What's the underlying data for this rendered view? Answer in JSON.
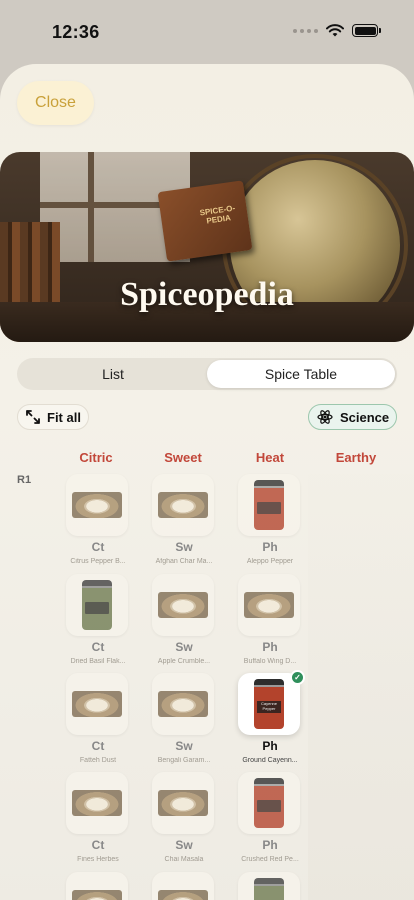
{
  "status": {
    "time": "12:36"
  },
  "sheet": {
    "close_label": "Close",
    "hero": {
      "title": "Spiceopedia",
      "book_title": "SPICE-O-PEDIA"
    },
    "segments": [
      {
        "label": "List",
        "active": false
      },
      {
        "label": "Spice Table",
        "active": true
      }
    ],
    "fit_all_label": "Fit all",
    "science_label": "Science",
    "columns": [
      "Citric",
      "Sweet",
      "Heat",
      "Earthy"
    ],
    "row_label": "R1",
    "tiles": {
      "citric": [
        {
          "symbol": "Ct",
          "name": "Citrus Pepper B...",
          "kind": "plate"
        },
        {
          "symbol": "Ct",
          "name": "Dried Basil Flak...",
          "kind": "jar"
        },
        {
          "symbol": "Ct",
          "name": "Fatteh Dust",
          "kind": "plate"
        },
        {
          "symbol": "Ct",
          "name": "Fines Herbes",
          "kind": "plate"
        }
      ],
      "sweet": [
        {
          "symbol": "Sw",
          "name": "Afghan Char Ma...",
          "kind": "plate"
        },
        {
          "symbol": "Sw",
          "name": "Apple Crumble...",
          "kind": "plate"
        },
        {
          "symbol": "Sw",
          "name": "Bengali Garam...",
          "kind": "plate"
        },
        {
          "symbol": "Sw",
          "name": "Chai Masala",
          "kind": "plate"
        }
      ],
      "heat": [
        {
          "symbol": "Ph",
          "name": "Aleppo Pepper",
          "kind": "jar-red"
        },
        {
          "symbol": "Ph",
          "name": "Buffalo Wing D...",
          "kind": "plate"
        },
        {
          "symbol": "Ph",
          "name": "Ground Cayenn...",
          "kind": "jar-red",
          "selected": true,
          "jar_text": "Cayenne Pepper"
        },
        {
          "symbol": "Ph",
          "name": "Crushed Red Pe...",
          "kind": "jar-red"
        }
      ]
    }
  }
}
